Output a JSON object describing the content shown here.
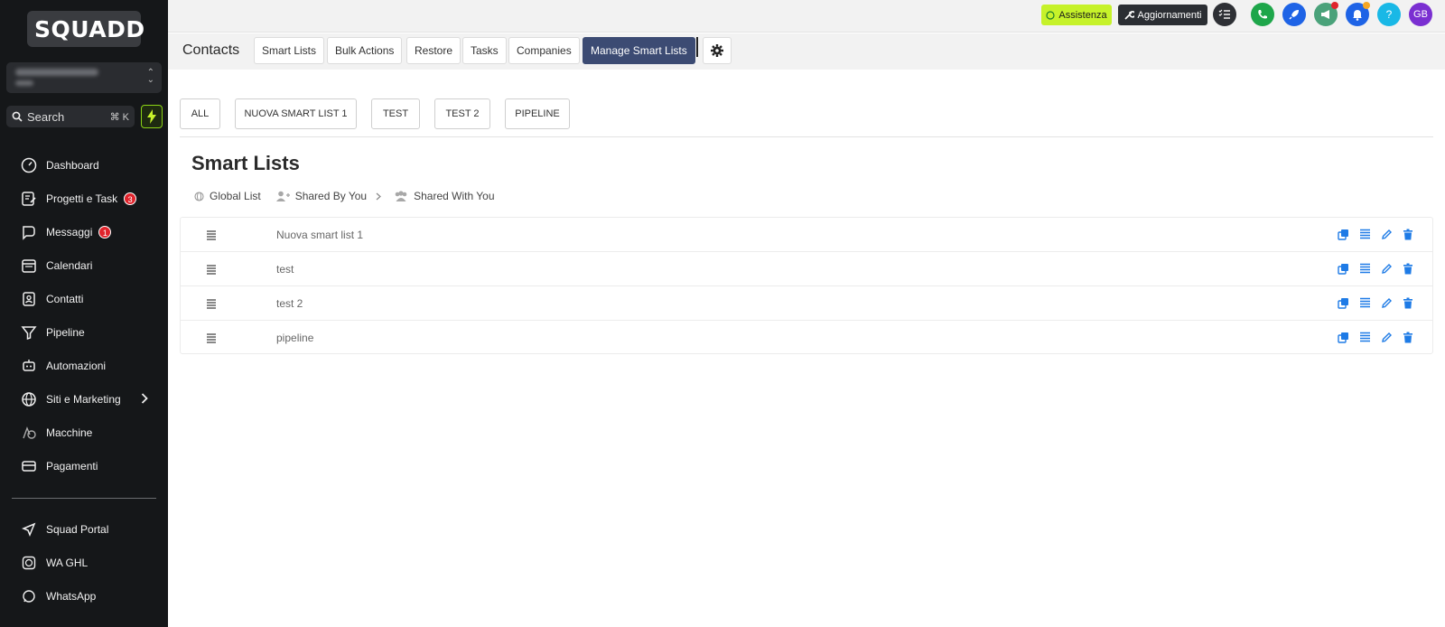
{
  "brand": {
    "name": "SQUADD"
  },
  "sidebar": {
    "search": {
      "label": "Search",
      "shortcut": "⌘ K"
    },
    "items": [
      {
        "label": "Dashboard",
        "icon": "gauge-icon"
      },
      {
        "label": "Progetti e Task",
        "icon": "edit-list-icon",
        "badge": "3"
      },
      {
        "label": "Messaggi",
        "icon": "chat-icon",
        "badge": "1"
      },
      {
        "label": "Calendari",
        "icon": "calendar-icon"
      },
      {
        "label": "Contatti",
        "icon": "contact-card-icon"
      },
      {
        "label": "Pipeline",
        "icon": "funnel-icon"
      },
      {
        "label": "Automazioni",
        "icon": "robot-icon"
      },
      {
        "label": "Siti e Marketing",
        "icon": "globe-icon"
      },
      {
        "label": "Macchine",
        "icon": "shapes-icon"
      },
      {
        "label": "Pagamenti",
        "icon": "card-icon"
      }
    ],
    "bottom_items": [
      {
        "label": "Squad Portal",
        "icon": "send-icon"
      },
      {
        "label": "WA GHL",
        "icon": "whatsapp-square-icon"
      },
      {
        "label": "WhatsApp",
        "icon": "whatsapp-icon"
      }
    ]
  },
  "topbar": {
    "assist_label": "Assistenza",
    "updates_label": "Aggiornamenti",
    "avatar_initials": "GB",
    "help_label": "?"
  },
  "tabbar": {
    "title": "Contacts",
    "tabs": [
      "Smart Lists",
      "Bulk Actions",
      "Restore",
      "Tasks",
      "Companies",
      "Manage Smart Lists"
    ],
    "active_tab": "Manage Smart Lists"
  },
  "filters": [
    "ALL",
    "NUOVA SMART LIST 1",
    "TEST",
    "TEST 2",
    "PIPELINE"
  ],
  "main": {
    "title": "Smart Lists",
    "share_tabs": [
      "Global List",
      "Shared By You",
      "Shared With You"
    ]
  },
  "lists": [
    {
      "name": "Nuova smart list 1"
    },
    {
      "name": "test"
    },
    {
      "name": "test 2"
    },
    {
      "name": "pipeline"
    }
  ],
  "colors": {
    "sidebar_bg": "#151719",
    "accent_green": "#c6f22a",
    "active_tab": "#3c4b73",
    "action_blue": "#1e7be6",
    "badge_red": "#e0242c"
  }
}
